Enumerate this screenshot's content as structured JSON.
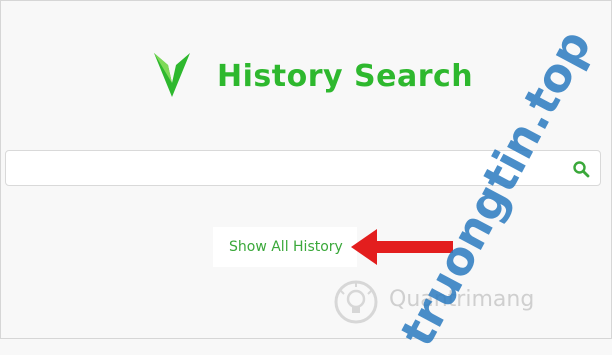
{
  "header": {
    "title": "History Search",
    "logo_icon": "check-v-icon",
    "accent_color": "#2eb82e"
  },
  "search": {
    "value": "",
    "placeholder": "",
    "button_icon": "search-icon"
  },
  "actions": {
    "show_all_label": "Show All History"
  },
  "annotation": {
    "arrow_icon": "red-arrow-icon",
    "arrow_color": "#e31e1e"
  },
  "watermark": {
    "text": "Quantrimang",
    "diagonal_text": "truongtin.top"
  }
}
